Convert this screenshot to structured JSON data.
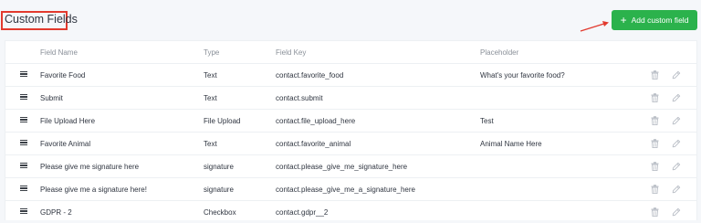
{
  "header": {
    "title": "Custom Fields",
    "add_button_label": "Add custom field",
    "add_button_icon": "plus-icon"
  },
  "colors": {
    "accent": "#2bb24c",
    "highlight": "#e23a2e",
    "background": "#f5f7fa"
  },
  "table": {
    "columns": [
      "Field Name",
      "Type",
      "Field Key",
      "Placeholder"
    ],
    "rows": [
      {
        "name": "Favorite Food",
        "type": "Text",
        "key": "contact.favorite_food",
        "placeholder": "What's your favorite food?"
      },
      {
        "name": "Submit",
        "type": "Text",
        "key": "contact.submit",
        "placeholder": ""
      },
      {
        "name": "File Upload Here",
        "type": "File Upload",
        "key": "contact.file_upload_here",
        "placeholder": "Test"
      },
      {
        "name": "Favorite Animal",
        "type": "Text",
        "key": "contact.favorite_animal",
        "placeholder": "Animal Name Here"
      },
      {
        "name": "Please give me signature here",
        "type": "signature",
        "key": "contact.please_give_me_signature_here",
        "placeholder": ""
      },
      {
        "name": "Please give me a signature here!",
        "type": "signature",
        "key": "contact.please_give_me_a_signature_here",
        "placeholder": ""
      },
      {
        "name": "GDPR - 2",
        "type": "Checkbox",
        "key": "contact.gdpr__2",
        "placeholder": ""
      }
    ],
    "row_icons": [
      "drag-handle-icon",
      "trash-icon",
      "pencil-icon"
    ]
  }
}
